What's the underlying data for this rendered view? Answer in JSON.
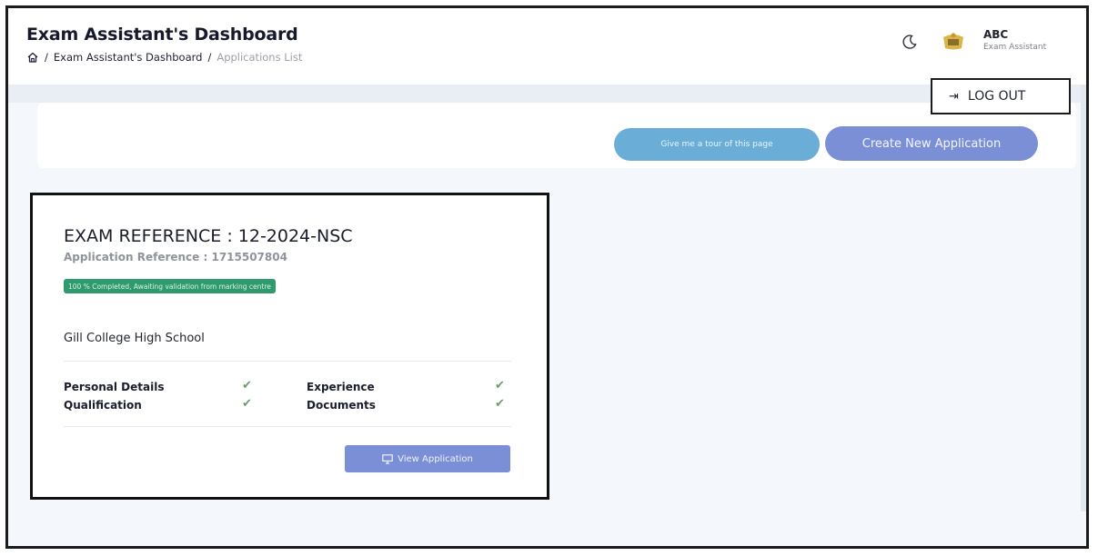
{
  "header": {
    "title": "Exam Assistant's Dashboard",
    "breadcrumb": [
      "Exam Assistant's Dashboard",
      "Applications List"
    ],
    "breadcrumb_separator": "/",
    "user": {
      "name": "ABC",
      "role": "Exam Assistant"
    }
  },
  "user_menu": {
    "logout_label": "LOG OUT"
  },
  "actions": {
    "tour_label": "Give me a tour of this page",
    "create_label": "Create New Application"
  },
  "application": {
    "exam_reference": "EXAM REFERENCE : 12-2024-NSC",
    "application_reference": "Application Reference : 1715507804",
    "status": "100 % Completed, Awaiting validation from marking centre",
    "school": "Gill College High School",
    "checklist": [
      {
        "label": "Personal Details",
        "done": true
      },
      {
        "label": "Experience",
        "done": true
      },
      {
        "label": "Qualification",
        "done": true
      },
      {
        "label": "Documents",
        "done": true
      }
    ],
    "view_label": "View Application"
  },
  "colors": {
    "accent": "#7b8fd6",
    "tour": "#6aaed8",
    "status_green": "#2f9a6e",
    "check": "#6b9c6b"
  }
}
